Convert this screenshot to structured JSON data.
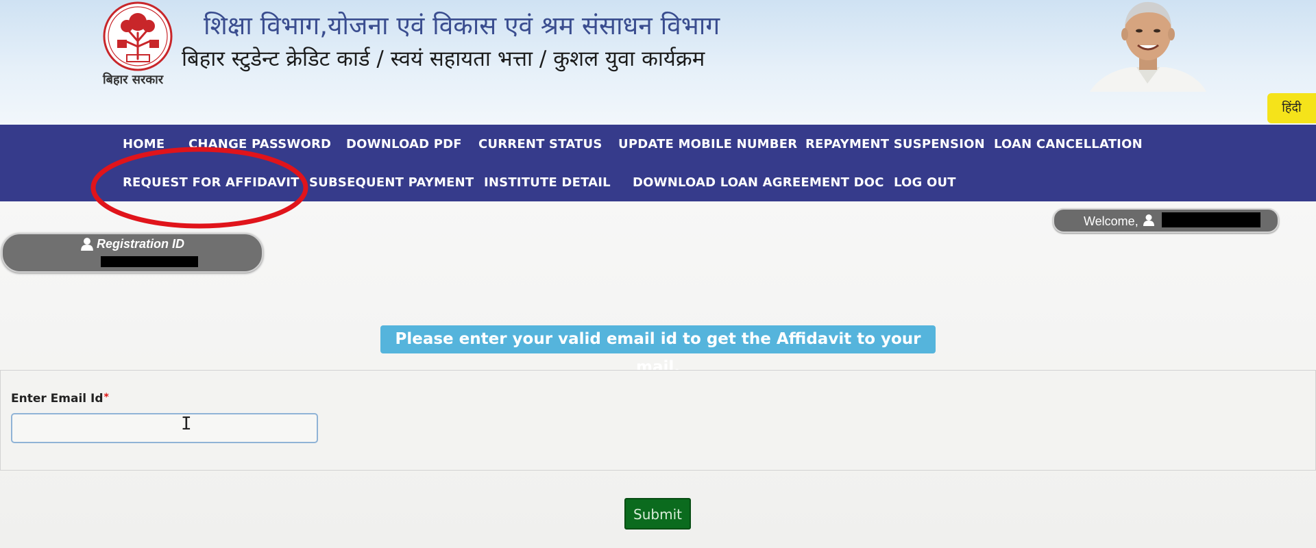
{
  "header": {
    "logo_caption": "बिहार सरकार",
    "title_line1": "शिक्षा विभाग,योजना एवं विकास एवं श्रम संसाधन विभाग",
    "title_line2": "बिहार स्टुडेन्ट क्रेडिट कार्ड / स्वयं सहायता भत्ता / कुशल युवा कार्यक्रम",
    "language_toggle": "हिंदी"
  },
  "nav": {
    "row1": [
      {
        "label": "HOME"
      },
      {
        "label": "CHANGE PASSWORD"
      },
      {
        "label": "DOWNLOAD PDF"
      },
      {
        "label": "CURRENT STATUS"
      },
      {
        "label": "UPDATE MOBILE NUMBER"
      },
      {
        "label": "REPAYMENT SUSPENSION"
      },
      {
        "label": "LOAN CANCELLATION"
      }
    ],
    "row2": [
      {
        "label": "REQUEST FOR AFFIDAVIT"
      },
      {
        "label": "SUBSEQUENT PAYMENT"
      },
      {
        "label": "INSTITUTE DETAIL"
      },
      {
        "label": "DOWNLOAD LOAN AGREEMENT DOC"
      },
      {
        "label": "LOG OUT"
      }
    ]
  },
  "welcome": {
    "label": "Welcome,"
  },
  "registration": {
    "label": "Registration ID"
  },
  "notice": {
    "text": "Please enter your valid email id to get the Affidavit to your mail."
  },
  "form": {
    "email_label": "Enter Email Id",
    "required_marker": "*",
    "email_value": "",
    "submit_label": "Submit"
  },
  "colors": {
    "nav_bg": "#363b8b",
    "notice_bg": "#55b4dc",
    "submit_bg": "#0b6b1e",
    "hindi_btn_bg": "#f5e31a",
    "annotation": "#e0141b"
  }
}
